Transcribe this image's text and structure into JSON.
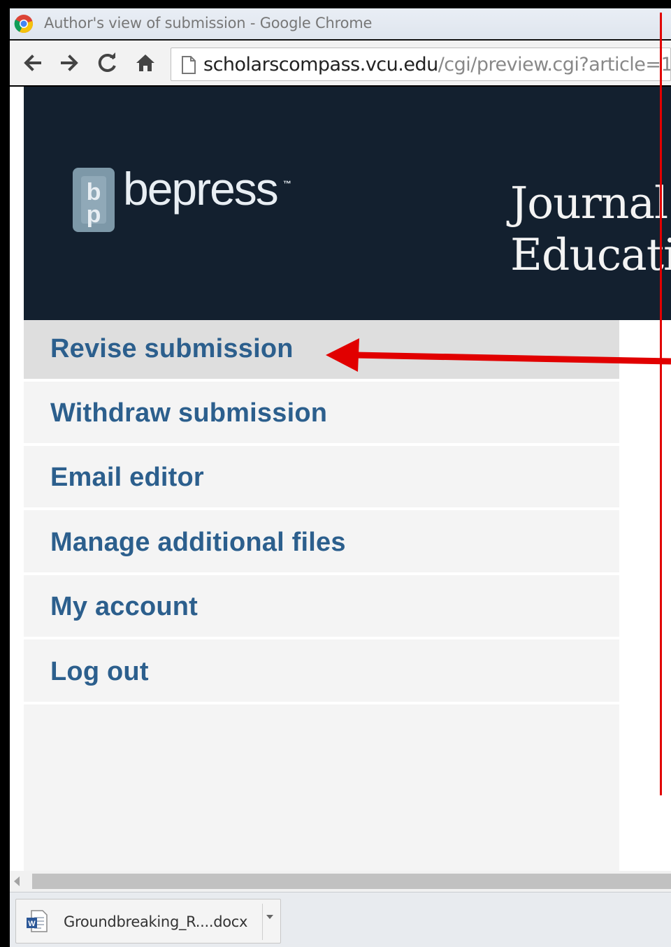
{
  "window": {
    "title": "Author's view of submission - Google Chrome"
  },
  "toolbar": {
    "back_icon": "back-arrow-icon",
    "forward_icon": "forward-arrow-icon",
    "reload_icon": "reload-icon",
    "home_icon": "home-icon",
    "url_domain": "scholarscompass.vcu.edu",
    "url_path": "/cgi/preview.cgi?article=1"
  },
  "header": {
    "logo_text": "bepress",
    "logo_mark": "™",
    "journal_title_line1": "Journal",
    "journal_title_line2": "Educati",
    "background_color": "#13202f"
  },
  "sidebar": {
    "items": [
      {
        "label": "Revise submission",
        "active": true
      },
      {
        "label": "Withdraw submission",
        "active": false
      },
      {
        "label": "Email editor",
        "active": false
      },
      {
        "label": "Manage additional files",
        "active": false
      },
      {
        "label": "My account",
        "active": false
      },
      {
        "label": "Log out",
        "active": false
      }
    ],
    "link_color": "#2c5f8d"
  },
  "annotation": {
    "arrow_color": "#e10000"
  },
  "downloads": {
    "file_name": "Groundbreaking_R....docx",
    "file_icon": "word-document-icon"
  }
}
